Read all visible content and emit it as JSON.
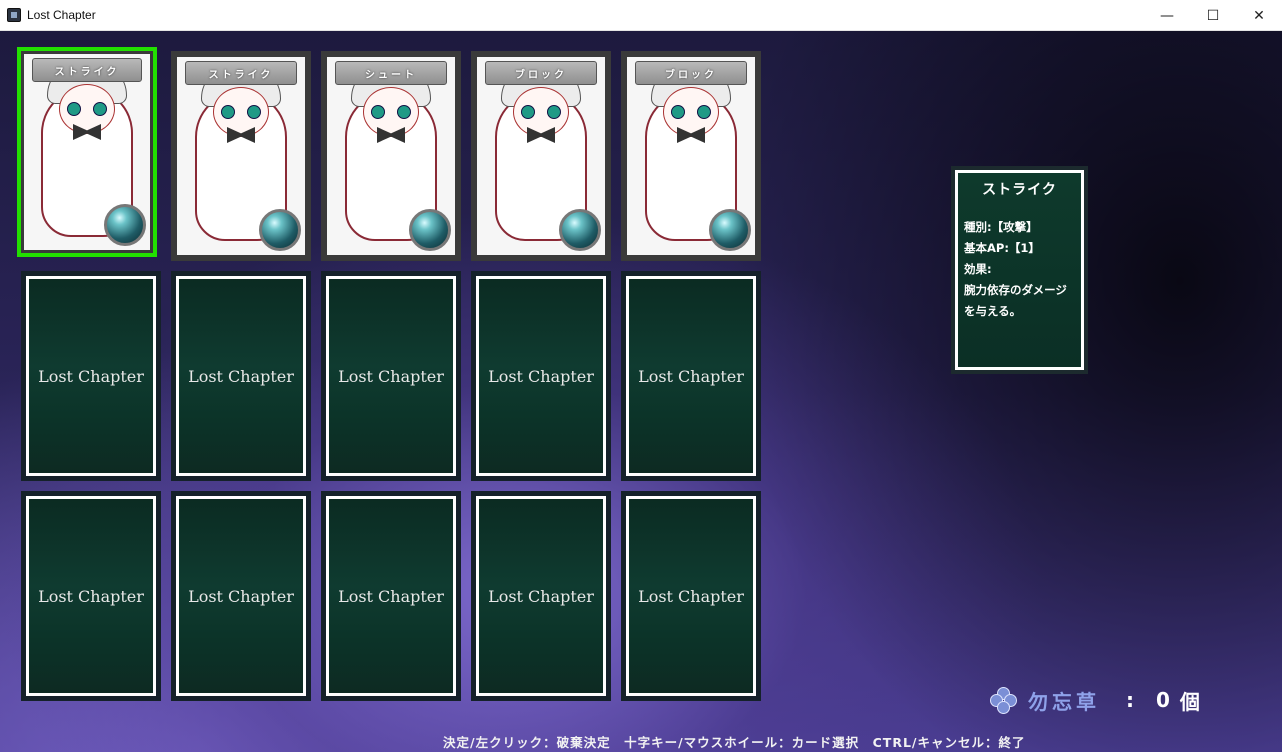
{
  "window": {
    "title": "Lost Chapter",
    "minimize_glyph": "—",
    "maximize_glyph": "☐",
    "close_glyph": "✕"
  },
  "hand": [
    {
      "name": "ストライク",
      "selected": true
    },
    {
      "name": "ストライク",
      "selected": false
    },
    {
      "name": "シュート",
      "selected": false
    },
    {
      "name": "ブロック",
      "selected": false
    },
    {
      "name": "ブロック",
      "selected": false
    }
  ],
  "card_back_label": "Lost Chapter",
  "info": {
    "title": "ストライク",
    "type_line": "種別:【攻撃】",
    "ap_line": "基本AP:【1】",
    "effect_label": "効果:",
    "effect_line1": "腕力依存のダメージ",
    "effect_line2": "を与える。"
  },
  "currency": {
    "icon": "flower-icon",
    "name": "勿忘草",
    "separator": ":",
    "count": "0",
    "unit": "個"
  },
  "help_text": "決定/左クリック：破棄決定　十字キー/マウスホイール：カード選択　CTRL/キャンセル：終了"
}
